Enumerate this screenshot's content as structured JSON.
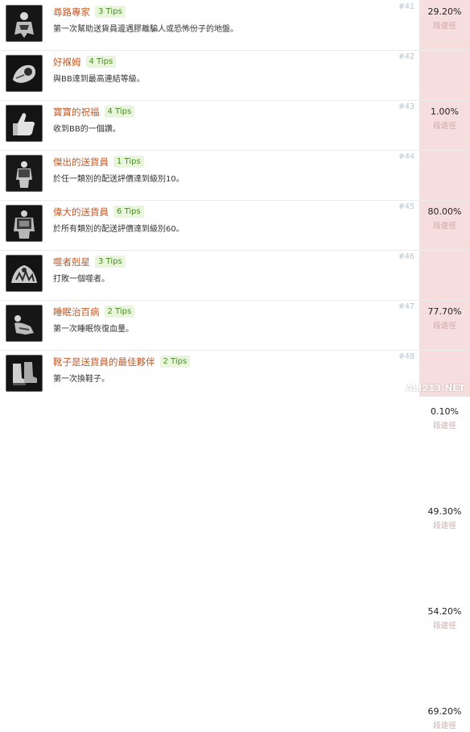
{
  "achievements": [
    {
      "title": "尋路專家",
      "tips": "3 Tips",
      "description": "第一次幫助送貨員邊遇膠離騙人或恐怖份子的地盤。",
      "number": "#41",
      "percent": "29.20%",
      "guide": "段途徑",
      "icon": "mechanical-figure-icon"
    },
    {
      "title": "好褓姆",
      "tips": "4 Tips",
      "description": "與BB達到最高連結等級。",
      "number": "#42",
      "percent": "1.00%",
      "guide": "段途徑",
      "icon": "baby-pod-icon"
    },
    {
      "title": "寶寶的祝福",
      "tips": "4 Tips",
      "description": "收到BB的一個讚。",
      "number": "#43",
      "percent": "80.00%",
      "guide": "段途徑",
      "icon": "thumbs-up-icon"
    },
    {
      "title": "傑出的送貨員",
      "tips": "1 Tips",
      "description": "於任一類別的配送評價達到級別10。",
      "number": "#44",
      "percent": "77.70%",
      "guide": "段途徑",
      "icon": "courier-figure-icon"
    },
    {
      "title": "偉大的送貨員",
      "tips": "6 Tips",
      "description": "於所有類別的配送評價達到級別60。",
      "number": "#45",
      "percent": "0.10%",
      "guide": "段途徑",
      "icon": "great-courier-icon"
    },
    {
      "title": "噬者剋星",
      "tips": "3 Tips",
      "description": "打敗一個噬者。",
      "number": "#46",
      "percent": "49.30%",
      "guide": "段途徑",
      "icon": "monster-icon"
    },
    {
      "title": "睡眠治百病",
      "tips": "2 Tips",
      "description": "第一次睡眠恢復血量。",
      "number": "#47",
      "percent": "54.20%",
      "guide": "段途徑",
      "icon": "sleeping-figure-icon"
    },
    {
      "title": "靴子是送貨員的最佳夥伴",
      "tips": "2 Tips",
      "description": "第一次換鞋子。",
      "number": "#48",
      "percent": "69.20%",
      "guide": "段途徑",
      "icon": "boots-icon"
    }
  ],
  "watermark": "ALI213.NET",
  "colors": {
    "title": "#c05a2a",
    "tips_bg": "#eaf6dc",
    "tips_text": "#4a8a2a",
    "panel_bg": "#f7dede",
    "number": "#b9c3cf"
  }
}
